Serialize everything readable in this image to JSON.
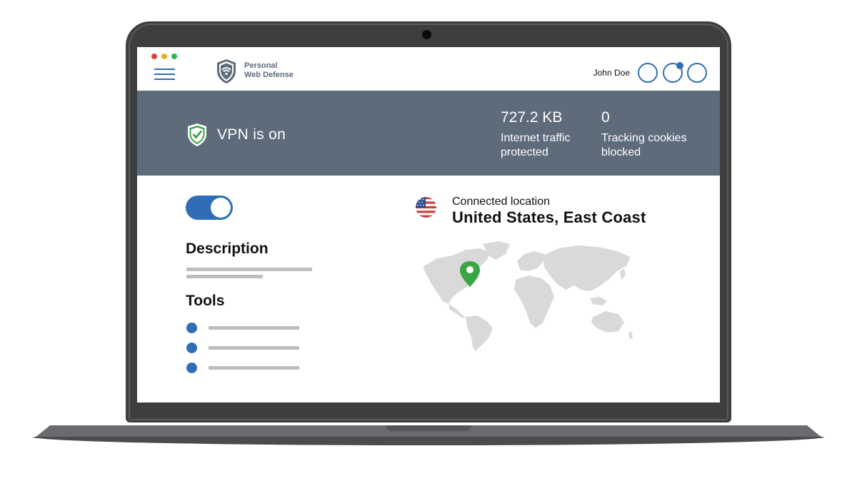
{
  "app": {
    "brand_line1": "Personal",
    "brand_line2": "Web Defense"
  },
  "window_dots": [
    "#e0443a",
    "#f0a81c",
    "#2fb44b"
  ],
  "header": {
    "user_name": "John Doe",
    "accent": "#2f6db5"
  },
  "status": {
    "vpn_label": "VPN is on",
    "traffic_value": "727.2 KB",
    "traffic_label_1": "Internet traffic",
    "traffic_label_2": "protected",
    "cookies_value": "0",
    "cookies_label_1": "Tracking cookies",
    "cookies_label_2": "blocked",
    "band_color": "#5e6b7b"
  },
  "main": {
    "vpn_toggle_on": true,
    "description_heading": "Description",
    "tools_heading": "Tools",
    "connected_label": "Connected location",
    "connected_value": "United States, East Coast",
    "pin_color": "#3aa544"
  },
  "icons": [
    "hamburger-menu-icon",
    "shield-wifi-logo",
    "shield-check-icon",
    "us-flag-icon",
    "location-pin-icon",
    "world-map"
  ]
}
